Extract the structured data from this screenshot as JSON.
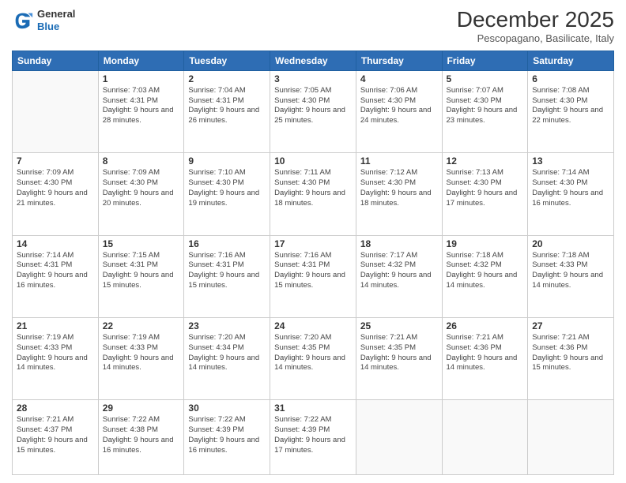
{
  "logo": {
    "general": "General",
    "blue": "Blue"
  },
  "header": {
    "month": "December 2025",
    "location": "Pescopagano, Basilicate, Italy"
  },
  "weekdays": [
    "Sunday",
    "Monday",
    "Tuesday",
    "Wednesday",
    "Thursday",
    "Friday",
    "Saturday"
  ],
  "weeks": [
    [
      {
        "day": "",
        "sunrise": "",
        "sunset": "",
        "daylight": ""
      },
      {
        "day": "1",
        "sunrise": "7:03 AM",
        "sunset": "4:31 PM",
        "daylight": "9 hours and 28 minutes."
      },
      {
        "day": "2",
        "sunrise": "7:04 AM",
        "sunset": "4:31 PM",
        "daylight": "9 hours and 26 minutes."
      },
      {
        "day": "3",
        "sunrise": "7:05 AM",
        "sunset": "4:30 PM",
        "daylight": "9 hours and 25 minutes."
      },
      {
        "day": "4",
        "sunrise": "7:06 AM",
        "sunset": "4:30 PM",
        "daylight": "9 hours and 24 minutes."
      },
      {
        "day": "5",
        "sunrise": "7:07 AM",
        "sunset": "4:30 PM",
        "daylight": "9 hours and 23 minutes."
      },
      {
        "day": "6",
        "sunrise": "7:08 AM",
        "sunset": "4:30 PM",
        "daylight": "9 hours and 22 minutes."
      }
    ],
    [
      {
        "day": "7",
        "sunrise": "7:09 AM",
        "sunset": "4:30 PM",
        "daylight": "9 hours and 21 minutes."
      },
      {
        "day": "8",
        "sunrise": "7:09 AM",
        "sunset": "4:30 PM",
        "daylight": "9 hours and 20 minutes."
      },
      {
        "day": "9",
        "sunrise": "7:10 AM",
        "sunset": "4:30 PM",
        "daylight": "9 hours and 19 minutes."
      },
      {
        "day": "10",
        "sunrise": "7:11 AM",
        "sunset": "4:30 PM",
        "daylight": "9 hours and 18 minutes."
      },
      {
        "day": "11",
        "sunrise": "7:12 AM",
        "sunset": "4:30 PM",
        "daylight": "9 hours and 18 minutes."
      },
      {
        "day": "12",
        "sunrise": "7:13 AM",
        "sunset": "4:30 PM",
        "daylight": "9 hours and 17 minutes."
      },
      {
        "day": "13",
        "sunrise": "7:14 AM",
        "sunset": "4:30 PM",
        "daylight": "9 hours and 16 minutes."
      }
    ],
    [
      {
        "day": "14",
        "sunrise": "7:14 AM",
        "sunset": "4:31 PM",
        "daylight": "9 hours and 16 minutes."
      },
      {
        "day": "15",
        "sunrise": "7:15 AM",
        "sunset": "4:31 PM",
        "daylight": "9 hours and 15 minutes."
      },
      {
        "day": "16",
        "sunrise": "7:16 AM",
        "sunset": "4:31 PM",
        "daylight": "9 hours and 15 minutes."
      },
      {
        "day": "17",
        "sunrise": "7:16 AM",
        "sunset": "4:31 PM",
        "daylight": "9 hours and 15 minutes."
      },
      {
        "day": "18",
        "sunrise": "7:17 AM",
        "sunset": "4:32 PM",
        "daylight": "9 hours and 14 minutes."
      },
      {
        "day": "19",
        "sunrise": "7:18 AM",
        "sunset": "4:32 PM",
        "daylight": "9 hours and 14 minutes."
      },
      {
        "day": "20",
        "sunrise": "7:18 AM",
        "sunset": "4:33 PM",
        "daylight": "9 hours and 14 minutes."
      }
    ],
    [
      {
        "day": "21",
        "sunrise": "7:19 AM",
        "sunset": "4:33 PM",
        "daylight": "9 hours and 14 minutes."
      },
      {
        "day": "22",
        "sunrise": "7:19 AM",
        "sunset": "4:33 PM",
        "daylight": "9 hours and 14 minutes."
      },
      {
        "day": "23",
        "sunrise": "7:20 AM",
        "sunset": "4:34 PM",
        "daylight": "9 hours and 14 minutes."
      },
      {
        "day": "24",
        "sunrise": "7:20 AM",
        "sunset": "4:35 PM",
        "daylight": "9 hours and 14 minutes."
      },
      {
        "day": "25",
        "sunrise": "7:21 AM",
        "sunset": "4:35 PM",
        "daylight": "9 hours and 14 minutes."
      },
      {
        "day": "26",
        "sunrise": "7:21 AM",
        "sunset": "4:36 PM",
        "daylight": "9 hours and 14 minutes."
      },
      {
        "day": "27",
        "sunrise": "7:21 AM",
        "sunset": "4:36 PM",
        "daylight": "9 hours and 15 minutes."
      }
    ],
    [
      {
        "day": "28",
        "sunrise": "7:21 AM",
        "sunset": "4:37 PM",
        "daylight": "9 hours and 15 minutes."
      },
      {
        "day": "29",
        "sunrise": "7:22 AM",
        "sunset": "4:38 PM",
        "daylight": "9 hours and 16 minutes."
      },
      {
        "day": "30",
        "sunrise": "7:22 AM",
        "sunset": "4:39 PM",
        "daylight": "9 hours and 16 minutes."
      },
      {
        "day": "31",
        "sunrise": "7:22 AM",
        "sunset": "4:39 PM",
        "daylight": "9 hours and 17 minutes."
      },
      {
        "day": "",
        "sunrise": "",
        "sunset": "",
        "daylight": ""
      },
      {
        "day": "",
        "sunrise": "",
        "sunset": "",
        "daylight": ""
      },
      {
        "day": "",
        "sunrise": "",
        "sunset": "",
        "daylight": ""
      }
    ]
  ]
}
